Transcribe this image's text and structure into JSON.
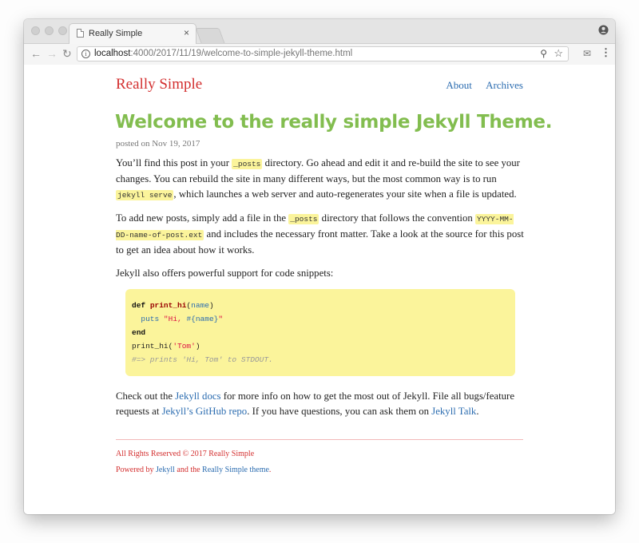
{
  "browser": {
    "tab_title": "Really Simple",
    "tab_close": "×",
    "url_host": "localhost",
    "url_path": ":4000/2017/11/19/welcome-to-simple-jekyll-theme.html"
  },
  "site": {
    "title": "Really Simple",
    "nav": [
      "About",
      "Archives"
    ]
  },
  "post": {
    "title": "Welcome to the really simple Jekyll Theme.",
    "meta": "posted on Nov 19, 2017",
    "p1": {
      "a": "You’ll find this post in your ",
      "code1": "_posts",
      "b": " directory. Go ahead and edit it and re-build the site to see your changes. You can rebuild the site in many different ways, but the most common way is to run ",
      "code2": "jekyll serve",
      "c": ", which launches a web server and auto-regenerates your site when a file is updated."
    },
    "p2": {
      "a": "To add new posts, simply add a file in the ",
      "code1": "_posts",
      "b": " directory that follows the convention ",
      "code2": "YYYY-MM-DD-name-of-post.ext",
      "c": " and includes the necessary front matter. Take a look at the source for this post to get an idea about how it works."
    },
    "p3": "Jekyll also offers powerful support for code snippets:",
    "code": {
      "l1_kw": "def",
      "l1_fn": "print_hi",
      "l1_open": "(",
      "l1_arg": "name",
      "l1_close": ")",
      "l2_indent": "  puts ",
      "l2_str_a": "\"Hi, ",
      "l2_interp": "#{name}",
      "l2_str_b": "\"",
      "l3_kw": "end",
      "l4_call": "print_hi(",
      "l4_str": "'Tom'",
      "l4_close": ")",
      "l5_comment": "#=> prints 'Hi, Tom' to STDOUT."
    },
    "p4": {
      "a": "Check out the ",
      "link1": "Jekyll docs",
      "b": " for more info on how to get the most out of Jekyll. File all bugs/feature requests at ",
      "link2": "Jekyll’s GitHub repo",
      "c": ". If you have questions, you can ask them on ",
      "link3": "Jekyll Talk",
      "d": "."
    }
  },
  "footer": {
    "copyright": "All Rights Reserved © 2017 Really Simple",
    "powered_a": "Powered by ",
    "powered_link1": "Jekyll",
    "powered_b": " and the ",
    "powered_link2": "Really Simple theme",
    "powered_c": "."
  },
  "colors": {
    "site_title": "#d32f2f",
    "post_title": "#82bd4f",
    "link": "#2b6cb0",
    "code_bg": "#fbf49b"
  }
}
